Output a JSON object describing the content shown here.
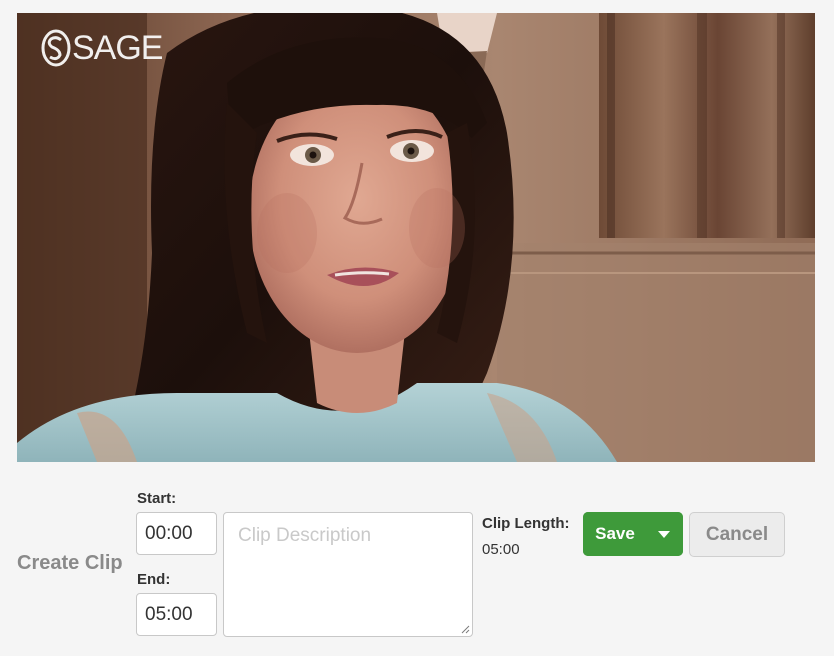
{
  "video": {
    "logo_text": "SAGE",
    "logo_icon": "sage-s-icon",
    "frame_description": "interview-still"
  },
  "clip": {
    "section_label": "Create Clip",
    "start_label": "Start:",
    "start_value": "00:00",
    "end_label": "End:",
    "end_value": "05:00",
    "description_placeholder": "Clip Description",
    "description_value": "",
    "length_label": "Clip Length:",
    "length_value": "05:00"
  },
  "actions": {
    "save_label": "Save",
    "save_caret_icon": "caret-down-icon",
    "cancel_label": "Cancel"
  },
  "colors": {
    "save_green": "#3e9a3a",
    "cancel_bg": "#ececec",
    "muted_text": "#8a8a8a",
    "page_bg": "#f5f5f5"
  }
}
